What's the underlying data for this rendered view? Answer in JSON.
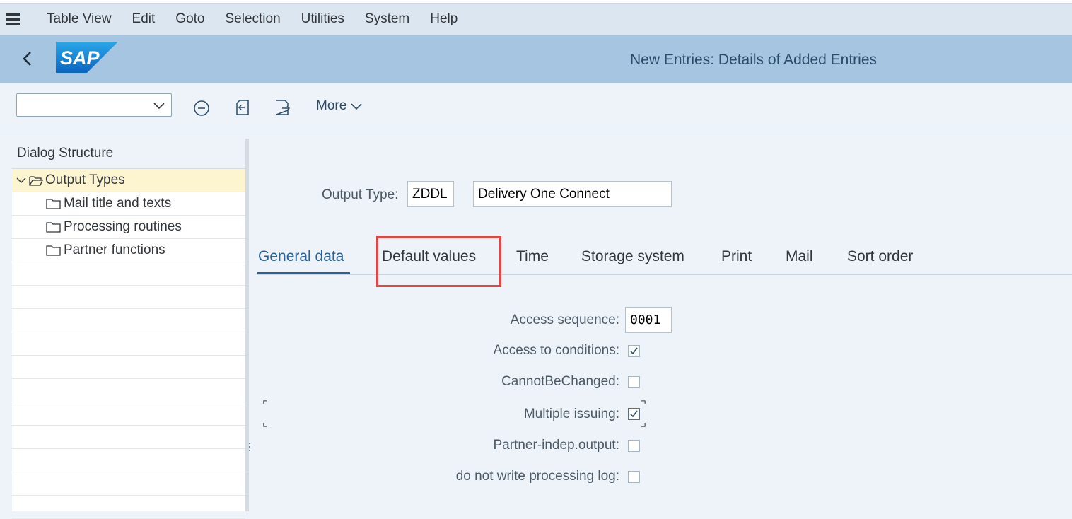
{
  "menu": {
    "items": [
      {
        "label": "Table View"
      },
      {
        "label": "Edit"
      },
      {
        "label": "Goto"
      },
      {
        "label": "Selection"
      },
      {
        "label": "Utilities"
      },
      {
        "label": "System"
      },
      {
        "label": "Help"
      }
    ]
  },
  "header": {
    "logo_text": "SAP",
    "title": "New Entries: Details of Added Entries"
  },
  "toolbar": {
    "command_field_value": "",
    "more_label": "More"
  },
  "dialog_structure": {
    "title": "Dialog Structure",
    "items": [
      {
        "label": "Output Types",
        "selected": true
      },
      {
        "label": "Mail title and texts"
      },
      {
        "label": "Processing routines"
      },
      {
        "label": "Partner functions"
      }
    ]
  },
  "output_type": {
    "label": "Output Type:",
    "code": "ZDDL",
    "description": "Delivery One Connect"
  },
  "tabs": [
    {
      "label": "General data",
      "active": true
    },
    {
      "label": "Default values",
      "highlighted": true
    },
    {
      "label": "Time"
    },
    {
      "label": "Storage system"
    },
    {
      "label": "Print"
    },
    {
      "label": "Mail"
    },
    {
      "label": "Sort order"
    }
  ],
  "general_data": {
    "access_sequence_label": "Access sequence:",
    "access_sequence_value": "0001",
    "fields": [
      {
        "label": "Access to conditions:",
        "checked": true
      },
      {
        "label": "CannotBeChanged:",
        "checked": false
      },
      {
        "label": "Multiple issuing:",
        "checked": true
      },
      {
        "label": "Partner-indep.output:",
        "checked": false
      },
      {
        "label": "do not write processing log:",
        "checked": false
      }
    ]
  },
  "colors": {
    "menubar": "#dbe6f1",
    "header": "#a5c5e1",
    "active_tab": "#2a6295",
    "highlight": "#e04848",
    "selected_row": "#fdf4d0"
  }
}
